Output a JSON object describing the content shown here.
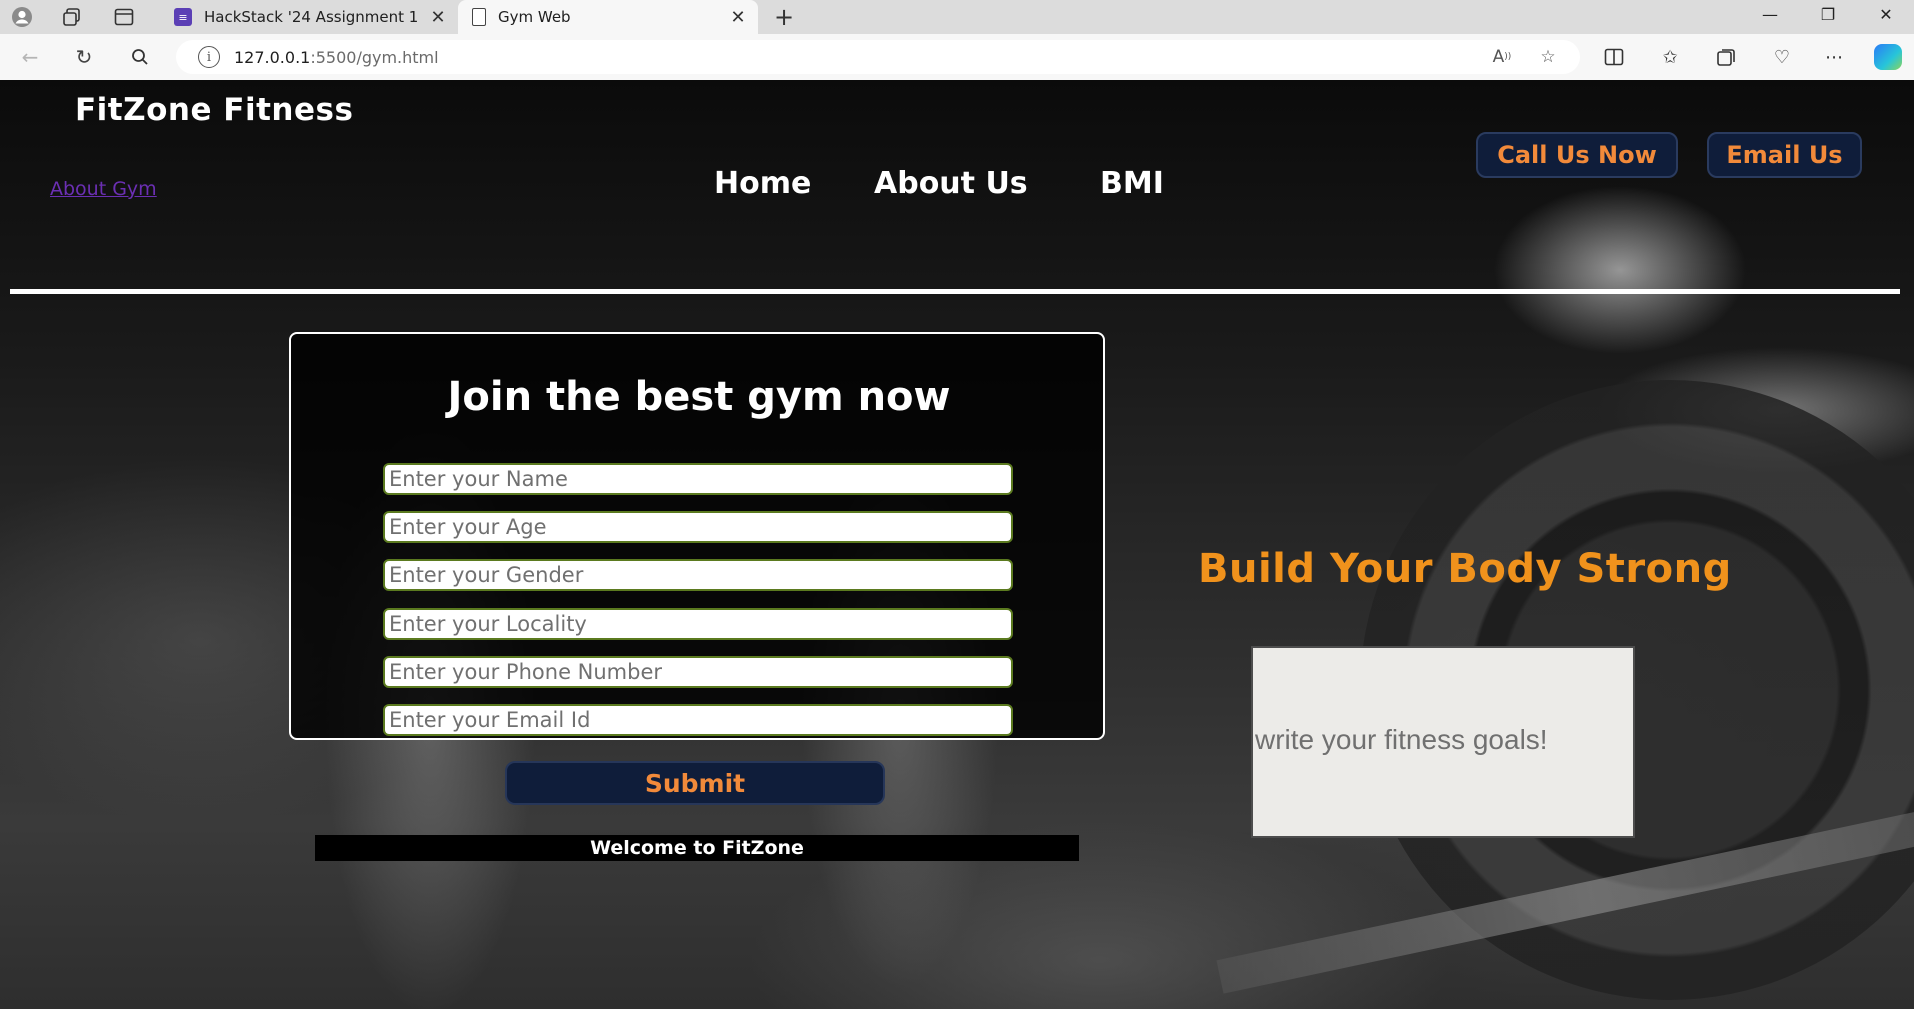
{
  "browser": {
    "tabs": [
      {
        "title": "HackStack '24 Assignment 1",
        "favicon": "forms-icon"
      },
      {
        "title": "Gym Web",
        "favicon": "page-icon"
      }
    ],
    "url_host": "127.0.0.1",
    "url_rest": ":5500/gym.html",
    "new_tab": "+",
    "minimize": "—",
    "restore": "❐",
    "close": "✕"
  },
  "page": {
    "brand": "FitZone Fitness",
    "about_link": "About Gym",
    "nav": [
      "Home",
      "About Us",
      "BMI"
    ],
    "call_button": "Call Us Now",
    "email_button": "Email Us",
    "form": {
      "title": "Join the best gym now",
      "fields": [
        {
          "placeholder": "Enter your Name"
        },
        {
          "placeholder": "Enter your Age"
        },
        {
          "placeholder": "Enter your Gender"
        },
        {
          "placeholder": "Enter your Locality"
        },
        {
          "placeholder": "Enter your Phone Number"
        },
        {
          "placeholder": "Enter your Email Id"
        }
      ],
      "submit": "Submit"
    },
    "welcome": "Welcome to FitZone",
    "headline": "Build Your Body Strong",
    "goals_placeholder": "write your fitness goals!"
  },
  "colors": {
    "accent_orange": "#f0921c",
    "button_navy": "#0f1d3a",
    "link_purple": "#6b2fb3"
  }
}
